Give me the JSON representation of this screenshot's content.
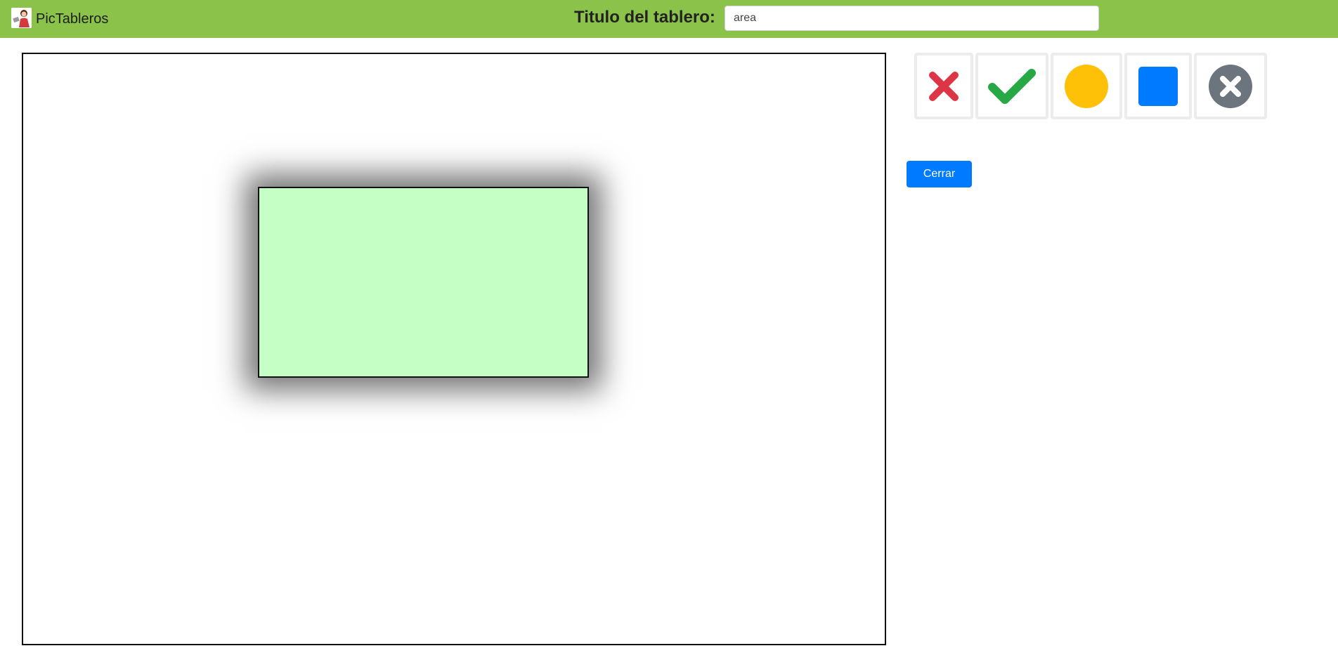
{
  "header": {
    "brand": "PicTableros",
    "board_title_label": "Titulo del tablero:",
    "board_title_value": "area"
  },
  "palette": [
    {
      "name": "cross-icon",
      "color": "#dc3545"
    },
    {
      "name": "check-icon",
      "color": "#28a745"
    },
    {
      "name": "circle-icon",
      "color": "#ffc107"
    },
    {
      "name": "square-icon",
      "color": "#007bff"
    },
    {
      "name": "close-circle-icon",
      "color": "#6c757d"
    }
  ],
  "canvas": {
    "shape": {
      "type": "rectangle",
      "fill": "#c6ffc6",
      "border": "#111111"
    }
  },
  "actions": {
    "close_label": "Cerrar"
  },
  "colors": {
    "topbar": "#8bc34a",
    "primary": "#007bff"
  }
}
